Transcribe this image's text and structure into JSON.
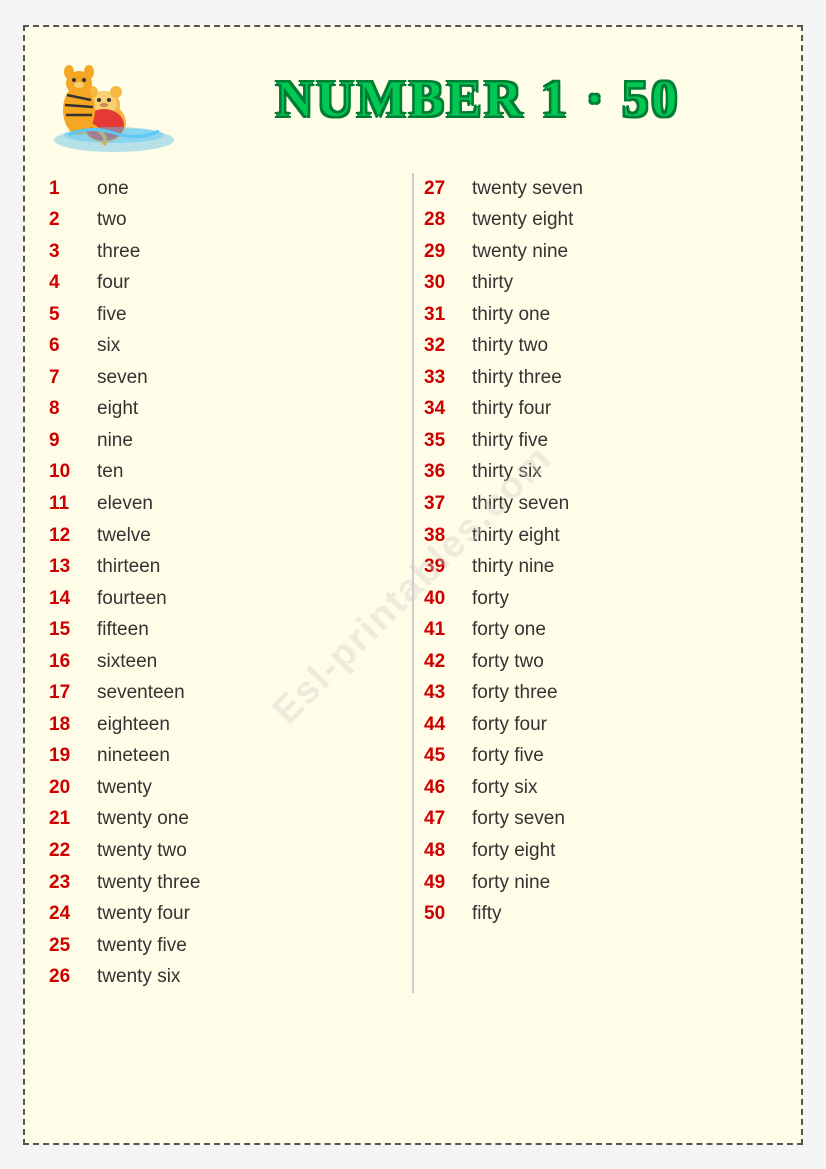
{
  "title": "NUMBER 1 · 50",
  "watermark": "Esl-printables.com",
  "left_numbers": [
    {
      "num": "1",
      "word": "one"
    },
    {
      "num": "2",
      "word": "two"
    },
    {
      "num": "3",
      "word": "three"
    },
    {
      "num": "4",
      "word": "four"
    },
    {
      "num": "5",
      "word": "five"
    },
    {
      "num": "6",
      "word": "six"
    },
    {
      "num": "7",
      "word": "seven"
    },
    {
      "num": "8",
      "word": "eight"
    },
    {
      "num": "9",
      "word": "nine"
    },
    {
      "num": "10",
      "word": "ten"
    },
    {
      "num": "11",
      "word": "eleven"
    },
    {
      "num": "12",
      "word": "twelve"
    },
    {
      "num": "13",
      "word": "thirteen"
    },
    {
      "num": "14",
      "word": "fourteen"
    },
    {
      "num": "15",
      "word": "fifteen"
    },
    {
      "num": "16",
      "word": "sixteen"
    },
    {
      "num": "17",
      "word": "seventeen"
    },
    {
      "num": "18",
      "word": "eighteen"
    },
    {
      "num": "19",
      "word": "nineteen"
    },
    {
      "num": "20",
      "word": "twenty"
    },
    {
      "num": "21",
      "word": "twenty one"
    },
    {
      "num": "22",
      "word": "twenty two"
    },
    {
      "num": "23",
      "word": "twenty three"
    },
    {
      "num": "24",
      "word": "twenty four"
    },
    {
      "num": "25",
      "word": " twenty five"
    },
    {
      "num": "26",
      "word": " twenty six"
    }
  ],
  "right_numbers": [
    {
      "num": "27",
      "word": "twenty seven"
    },
    {
      "num": "28",
      "word": "twenty eight"
    },
    {
      "num": "29",
      "word": "twenty nine"
    },
    {
      "num": "30",
      "word": "thirty"
    },
    {
      "num": "31",
      "word": "thirty one"
    },
    {
      "num": "32",
      "word": "thirty two"
    },
    {
      "num": "33",
      "word": "thirty three"
    },
    {
      "num": "34",
      "word": "thirty four"
    },
    {
      "num": "35",
      "word": "thirty five"
    },
    {
      "num": "36",
      "word": "thirty six"
    },
    {
      "num": "37",
      "word": "thirty seven"
    },
    {
      "num": "38",
      "word": "thirty eight"
    },
    {
      "num": "39",
      "word": "thirty nine"
    },
    {
      "num": "40",
      "word": "forty"
    },
    {
      "num": "41",
      "word": "forty one"
    },
    {
      "num": "42",
      "word": "forty two"
    },
    {
      "num": "43",
      "word": "forty three"
    },
    {
      "num": "44",
      "word": "forty four"
    },
    {
      "num": "45",
      "word": "forty five"
    },
    {
      "num": "46",
      "word": "forty six"
    },
    {
      "num": "47",
      "word": "forty seven"
    },
    {
      "num": "48",
      "word": "forty eight"
    },
    {
      "num": "49",
      "word": "forty nine"
    },
    {
      "num": "50",
      "word": "fifty"
    }
  ]
}
